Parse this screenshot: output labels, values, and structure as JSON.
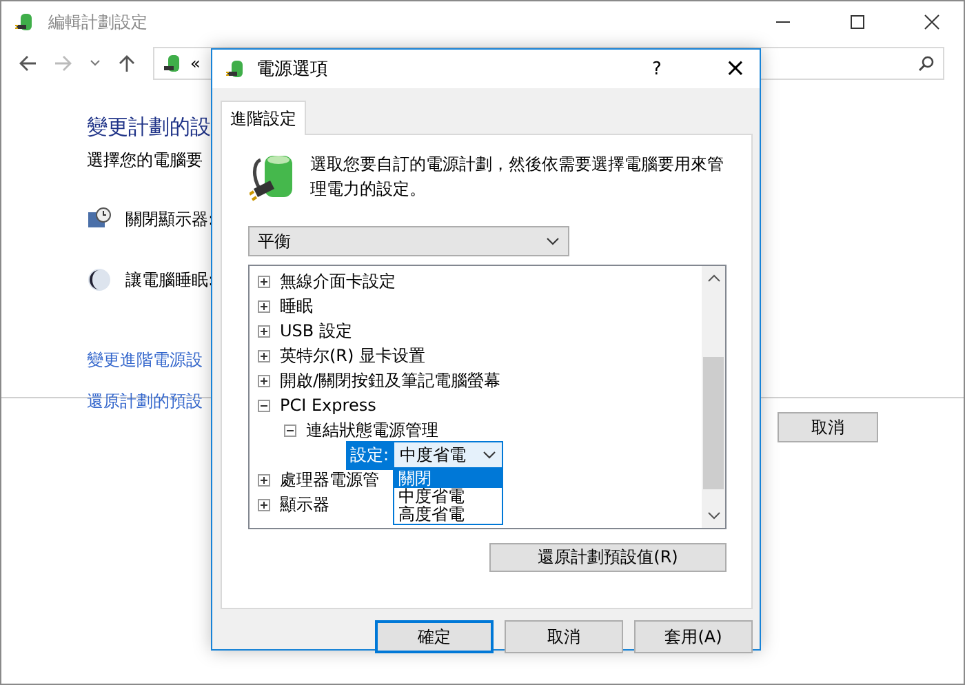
{
  "window": {
    "title": "編輯計劃設定",
    "address": "«",
    "heading": "變更計劃的設",
    "subtitle": "選擇您的電腦要",
    "settings": [
      {
        "kind": "display",
        "label": "關閉顯示器:"
      },
      {
        "kind": "sleep",
        "label": "讓電腦睡眠:"
      }
    ],
    "links": [
      "變更進階電源設",
      "還原計劃的預設"
    ],
    "cancel_button": "取消"
  },
  "dialog": {
    "title": "電源選項",
    "help": "?",
    "close": "×",
    "tabs": [
      {
        "label": "進階設定",
        "selected": true
      }
    ],
    "description": "選取您要自訂的電源計劃，然後依需要選擇電腦要用來管理電力的設定。",
    "plan": "平衡",
    "tree": [
      {
        "label": "無線介面卡設定",
        "expanded": false
      },
      {
        "label": "睡眠",
        "expanded": false
      },
      {
        "label": "USB 設定",
        "expanded": false
      },
      {
        "label": "英特尔(R) 显卡设置",
        "expanded": false
      },
      {
        "label": "開啟/關閉按鈕及筆記電腦螢幕",
        "expanded": false
      },
      {
        "label": "PCI Express",
        "expanded": true,
        "children": [
          {
            "label": "連結狀態電源管理",
            "expanded": true,
            "children": [
              {
                "kind": "setting",
                "label": "設定:",
                "value": "中度省電",
                "open": true,
                "options": [
                  {
                    "label": "關閉",
                    "highlighted": true
                  },
                  {
                    "label": "中度省電",
                    "highlighted": false
                  },
                  {
                    "label": "高度省電",
                    "highlighted": false
                  }
                ]
              }
            ]
          }
        ]
      },
      {
        "label": "處理器電源管",
        "expanded": false
      },
      {
        "label": "顯示器",
        "expanded": false
      }
    ],
    "restore_button": "還原計劃預設值(R)",
    "buttons": [
      {
        "label": "確定",
        "focused": true
      },
      {
        "label": "取消",
        "focused": false
      },
      {
        "label": "套用(A)",
        "focused": false
      }
    ]
  }
}
